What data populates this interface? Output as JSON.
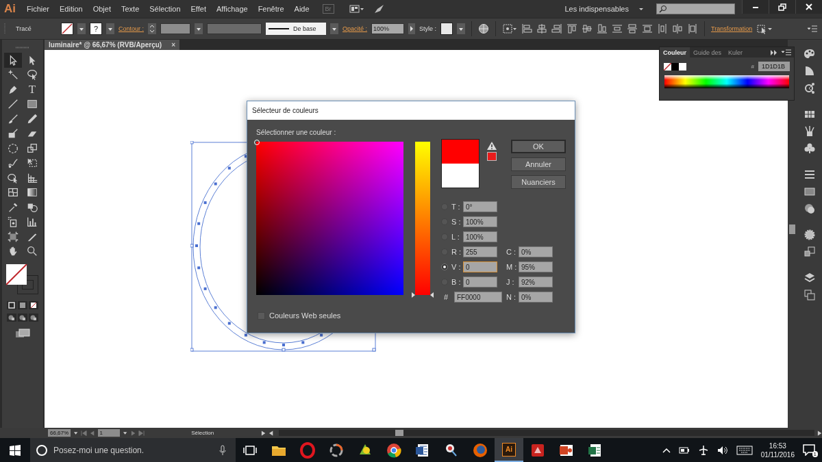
{
  "app": {
    "logo": "Ai",
    "bridge": "Br"
  },
  "menu": [
    "Fichier",
    "Edition",
    "Objet",
    "Texte",
    "Sélection",
    "Effet",
    "Affichage",
    "Fenêtre",
    "Aide"
  ],
  "workspace": "Les indispensables",
  "control_bar": {
    "selection_label": "Tracé",
    "stroke_unknown": "?",
    "stroke_link": "Contour :",
    "stroke_profile": "De base",
    "opacity_link": "Opacité :",
    "opacity": "100%",
    "style_label": "Style :",
    "transform_link": "Transformation"
  },
  "tools": [
    {
      "kind": "selection",
      "selected": true
    },
    {
      "kind": "direct-selection",
      "selected": false
    },
    {
      "kind": "magic-wand",
      "selected": false
    },
    {
      "kind": "lasso",
      "selected": false
    },
    {
      "kind": "pen",
      "selected": false
    },
    {
      "kind": "type",
      "glyph": "T",
      "selected": false
    },
    {
      "kind": "line",
      "selected": false
    },
    {
      "kind": "rectangle",
      "selected": false
    },
    {
      "kind": "paintbrush",
      "selected": false
    },
    {
      "kind": "pencil",
      "selected": false
    },
    {
      "kind": "shaper",
      "selected": false
    },
    {
      "kind": "eraser",
      "selected": false
    },
    {
      "kind": "rotate",
      "selected": false
    },
    {
      "kind": "scale",
      "selected": false
    },
    {
      "kind": "warp",
      "selected": false
    },
    {
      "kind": "free-transform",
      "selected": false
    },
    {
      "kind": "shape-builder",
      "selected": false
    },
    {
      "kind": "perspective",
      "selected": false
    },
    {
      "kind": "mesh",
      "selected": false
    },
    {
      "kind": "gradient",
      "selected": false
    },
    {
      "kind": "eyedropper",
      "selected": false
    },
    {
      "kind": "blend",
      "selected": false
    },
    {
      "kind": "symbol-sprayer",
      "selected": false
    },
    {
      "kind": "column-graph",
      "selected": false
    },
    {
      "kind": "artboard",
      "selected": false
    },
    {
      "kind": "slice",
      "selected": false
    },
    {
      "kind": "hand",
      "selected": false
    },
    {
      "kind": "zoom",
      "selected": false
    }
  ],
  "document_tab": {
    "title": "luminaire* @ 66,67% (RVB/Aperçu)",
    "close": "×"
  },
  "color_panel": {
    "tabs": [
      {
        "label": "Couleur",
        "selected": true
      },
      {
        "label": "Guide des",
        "selected": false
      },
      {
        "label": "Kuler",
        "selected": false
      }
    ],
    "hex_label": "#",
    "hex": "1D1D1B"
  },
  "color_picker": {
    "title": "Sélecteur de couleurs",
    "prompt": "Sélectionner une couleur :",
    "hue_slider": {
      "level": 0
    },
    "buttons": [
      {
        "label": "OK",
        "default": true
      },
      {
        "label": "Annuler",
        "default": false
      },
      {
        "label": "Nuanciers",
        "default": false
      }
    ],
    "fields": [
      {
        "label": "T :",
        "value": "0°",
        "selected": false,
        "focused": false
      },
      {
        "label": "S :",
        "value": "100%",
        "selected": false,
        "focused": false
      },
      {
        "label": "L :",
        "value": "100%",
        "selected": false,
        "focused": false
      },
      {
        "label": "R :",
        "value": "255",
        "selected": false,
        "focused": false
      },
      {
        "label": "V :",
        "value": "0",
        "selected": true,
        "focused": true
      },
      {
        "label": "B :",
        "value": "0",
        "selected": false,
        "focused": false
      }
    ],
    "hex": {
      "label": "#",
      "value": "FF0000"
    },
    "cmyk": [
      {
        "label": "C :",
        "value": "0%"
      },
      {
        "label": "M :",
        "value": "95%"
      },
      {
        "label": "J :",
        "value": "92%"
      },
      {
        "label": "N :",
        "value": "0%"
      }
    ],
    "web_only": {
      "label": "Couleurs Web seules",
      "checked": false
    }
  },
  "status_bar": {
    "zoom": "66,67%",
    "artboard": "1",
    "tool": "Sélection"
  },
  "taskbar": {
    "search_placeholder": "Posez-moi une question.",
    "apps": [
      {
        "kind": "folder",
        "selected": false
      },
      {
        "kind": "red-ring",
        "selected": false
      },
      {
        "kind": "swirl",
        "selected": false
      },
      {
        "kind": "green-app",
        "selected": false
      },
      {
        "kind": "tricolor",
        "selected": false
      },
      {
        "kind": "blue-doc",
        "selected": false
      },
      {
        "kind": "pin",
        "selected": false
      },
      {
        "kind": "orange-globe",
        "selected": false
      },
      {
        "kind": "illustrator",
        "label": "Ai",
        "selected": true
      },
      {
        "kind": "red-box",
        "selected": false
      },
      {
        "kind": "orange-box",
        "selected": false
      },
      {
        "kind": "green-sheet",
        "selected": false
      }
    ],
    "time": "16:53",
    "date": "01/11/2016",
    "notifications": "1"
  }
}
